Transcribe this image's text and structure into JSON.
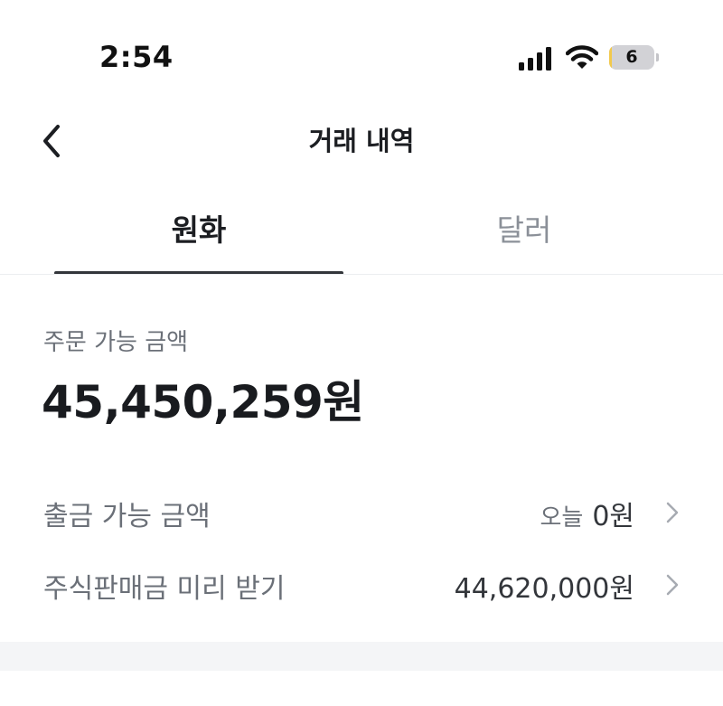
{
  "status_bar": {
    "time": "2:54",
    "battery_level": "6",
    "battery_fraction": 0.06,
    "signal_icon": "cellular-signal-icon",
    "wifi_icon": "wifi-icon"
  },
  "header": {
    "title": "거래 내역",
    "back_icon": "chevron-left-icon"
  },
  "tabs": [
    {
      "label": "원화",
      "active": true
    },
    {
      "label": "달러",
      "active": false
    }
  ],
  "balance": {
    "label": "주문 가능 금액",
    "amount": "45,450,259원"
  },
  "rows": [
    {
      "label": "출금 가능 금액",
      "value_prefix": "오늘",
      "value": "0원"
    },
    {
      "label": "주식판매금 미리 받기",
      "value_prefix": "",
      "value": "44,620,000원"
    }
  ],
  "colors": {
    "accent_dark": "#33363b",
    "muted_text": "#6b7078",
    "inactive_tab": "#8b9098",
    "battery_low": "#f2c94c"
  }
}
